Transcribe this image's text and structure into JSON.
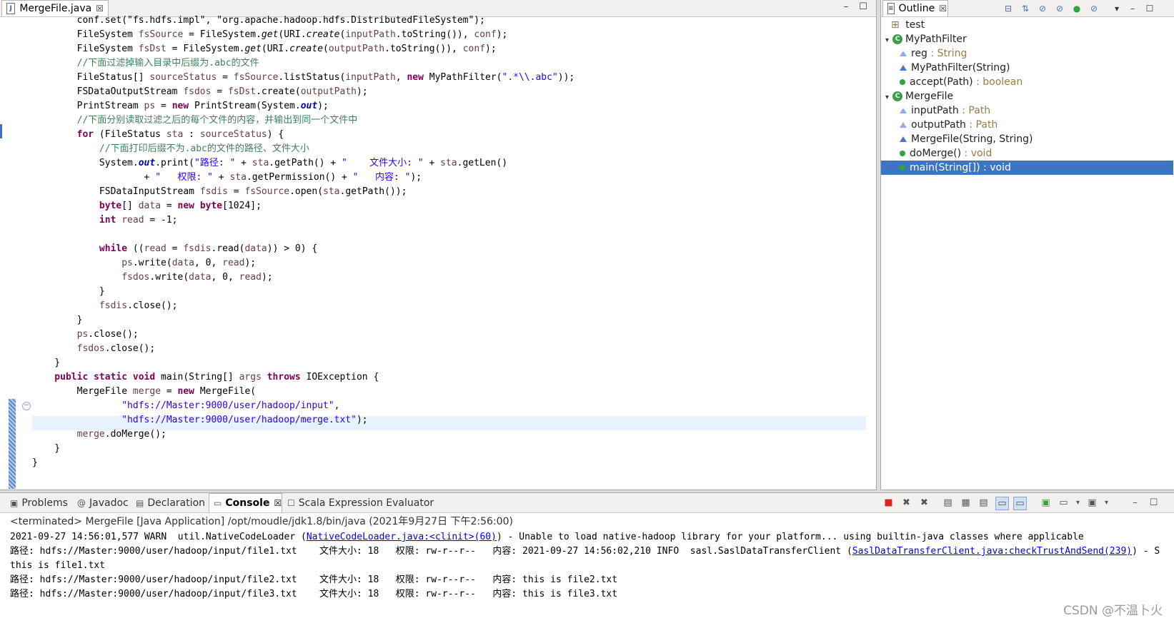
{
  "editor": {
    "tab_label": "MergeFile.java",
    "tab_close": "☒",
    "lines": [
      {
        "segs": [
          [
            "",
            "        conf.set(\"fs.hdfs.impl\", \"org.apache.hadoop.hdfs.DistributedFileSystem\");"
          ]
        ]
      },
      {
        "segs": [
          [
            "",
            "        FileSystem "
          ],
          [
            "var",
            "fsSource"
          ],
          [
            "",
            " = FileSystem."
          ],
          [
            "meth",
            "get"
          ],
          [
            "",
            "(URI."
          ],
          [
            "meth",
            "create"
          ],
          [
            "",
            "("
          ],
          [
            "var",
            "inputPath"
          ],
          [
            "",
            ".toString()), "
          ],
          [
            "var",
            "conf"
          ],
          [
            "",
            ");"
          ]
        ]
      },
      {
        "segs": [
          [
            "",
            "        FileSystem "
          ],
          [
            "var",
            "fsDst"
          ],
          [
            "",
            " = FileSystem."
          ],
          [
            "meth",
            "get"
          ],
          [
            "",
            "(URI."
          ],
          [
            "meth",
            "create"
          ],
          [
            "",
            "("
          ],
          [
            "var",
            "outputPath"
          ],
          [
            "",
            ".toString()), "
          ],
          [
            "var",
            "conf"
          ],
          [
            "",
            ");"
          ]
        ]
      },
      {
        "segs": [
          [
            "cmt",
            "        //下面过滤掉输入目录中后缀为.abc的文件"
          ]
        ]
      },
      {
        "segs": [
          [
            "",
            "        FileStatus[] "
          ],
          [
            "var",
            "sourceStatus"
          ],
          [
            "",
            " = "
          ],
          [
            "var",
            "fsSource"
          ],
          [
            "",
            ".listStatus("
          ],
          [
            "var",
            "inputPath"
          ],
          [
            "",
            ", "
          ],
          [
            "kw",
            "new"
          ],
          [
            "",
            " MyPathFilter("
          ],
          [
            "str",
            "\".*\\\\.abc\""
          ],
          [
            "",
            "));"
          ]
        ]
      },
      {
        "segs": [
          [
            "",
            "        FSDataOutputStream "
          ],
          [
            "var",
            "fsdos"
          ],
          [
            "",
            " = "
          ],
          [
            "var",
            "fsDst"
          ],
          [
            "",
            ".create("
          ],
          [
            "var",
            "outputPath"
          ],
          [
            "",
            ");"
          ]
        ]
      },
      {
        "segs": [
          [
            "",
            "        PrintStream "
          ],
          [
            "var",
            "ps"
          ],
          [
            "",
            " = "
          ],
          [
            "kw",
            "new"
          ],
          [
            "",
            " PrintStream(System."
          ],
          [
            "fld",
            "out"
          ],
          [
            "",
            ");"
          ]
        ]
      },
      {
        "segs": [
          [
            "cmt",
            "        //下面分别读取过滤之后的每个文件的内容，并输出到同一个文件中"
          ]
        ]
      },
      {
        "segs": [
          [
            "kw",
            "        for"
          ],
          [
            "",
            " (FileStatus "
          ],
          [
            "var",
            "sta"
          ],
          [
            "",
            " : "
          ],
          [
            "var",
            "sourceStatus"
          ],
          [
            "",
            ") {"
          ]
        ]
      },
      {
        "segs": [
          [
            "cmt",
            "            //下面打印后缀不为.abc的文件的路径、文件大小"
          ]
        ]
      },
      {
        "segs": [
          [
            "",
            "            System."
          ],
          [
            "fld",
            "out"
          ],
          [
            "",
            ".print("
          ],
          [
            "str",
            "\"路径: \""
          ],
          [
            "",
            " + "
          ],
          [
            "var",
            "sta"
          ],
          [
            "",
            ".getPath() + "
          ],
          [
            "str",
            "\"    文件大小: \""
          ],
          [
            "",
            " + "
          ],
          [
            "var",
            "sta"
          ],
          [
            "",
            ".getLen()"
          ]
        ]
      },
      {
        "segs": [
          [
            "",
            "                    + "
          ],
          [
            "str",
            "\"   权限: \""
          ],
          [
            "",
            " + "
          ],
          [
            "var",
            "sta"
          ],
          [
            "",
            ".getPermission() + "
          ],
          [
            "str",
            "\"   内容: \""
          ],
          [
            "",
            ");"
          ]
        ]
      },
      {
        "segs": [
          [
            "",
            "            FSDataInputStream "
          ],
          [
            "var",
            "fsdis"
          ],
          [
            "",
            " = "
          ],
          [
            "var",
            "fsSource"
          ],
          [
            "",
            ".open("
          ],
          [
            "var",
            "sta"
          ],
          [
            "",
            ".getPath());"
          ]
        ]
      },
      {
        "segs": [
          [
            "kw",
            "            byte"
          ],
          [
            "",
            "[] "
          ],
          [
            "var",
            "data"
          ],
          [
            "",
            " = "
          ],
          [
            "kw",
            "new"
          ],
          [
            "",
            " "
          ],
          [
            "kw",
            "byte"
          ],
          [
            "",
            "[1024];"
          ]
        ]
      },
      {
        "segs": [
          [
            "kw",
            "            int"
          ],
          [
            "",
            " "
          ],
          [
            "var",
            "read"
          ],
          [
            "",
            " = -1;"
          ]
        ]
      },
      {
        "segs": [
          [
            "",
            ""
          ]
        ]
      },
      {
        "segs": [
          [
            "kw",
            "            while"
          ],
          [
            "",
            " (("
          ],
          [
            "var",
            "read"
          ],
          [
            "",
            " = "
          ],
          [
            "var",
            "fsdis"
          ],
          [
            "",
            ".read("
          ],
          [
            "var",
            "data"
          ],
          [
            "",
            ")) > 0) {"
          ]
        ]
      },
      {
        "segs": [
          [
            "",
            "                "
          ],
          [
            "var",
            "ps"
          ],
          [
            "",
            ".write("
          ],
          [
            "var",
            "data"
          ],
          [
            "",
            ", 0, "
          ],
          [
            "var",
            "read"
          ],
          [
            "",
            ");"
          ]
        ]
      },
      {
        "segs": [
          [
            "",
            "                "
          ],
          [
            "var",
            "fsdos"
          ],
          [
            "",
            ".write("
          ],
          [
            "var",
            "data"
          ],
          [
            "",
            ", 0, "
          ],
          [
            "var",
            "read"
          ],
          [
            "",
            ");"
          ]
        ]
      },
      {
        "segs": [
          [
            "",
            "            }"
          ]
        ]
      },
      {
        "segs": [
          [
            "",
            "            "
          ],
          [
            "var",
            "fsdis"
          ],
          [
            "",
            ".close();"
          ]
        ]
      },
      {
        "segs": [
          [
            "",
            "        }"
          ]
        ]
      },
      {
        "segs": [
          [
            "",
            "        "
          ],
          [
            "var",
            "ps"
          ],
          [
            "",
            ".close();"
          ]
        ]
      },
      {
        "segs": [
          [
            "",
            "        "
          ],
          [
            "var",
            "fsdos"
          ],
          [
            "",
            ".close();"
          ]
        ]
      },
      {
        "segs": [
          [
            "",
            "    }"
          ]
        ]
      },
      {
        "segs": [
          [
            "kw",
            "    public static void"
          ],
          [
            "",
            " main(String[] "
          ],
          [
            "var",
            "args"
          ],
          [
            "",
            " "
          ],
          [
            "kw",
            "throws"
          ],
          [
            "",
            " IOException {"
          ]
        ]
      },
      {
        "segs": [
          [
            "",
            "        MergeFile "
          ],
          [
            "var",
            "merge"
          ],
          [
            "",
            " = "
          ],
          [
            "kw",
            "new"
          ],
          [
            "",
            " MergeFile("
          ]
        ]
      },
      {
        "segs": [
          [
            "",
            "                "
          ],
          [
            "str",
            "\"hdfs://Master:9000/user/hadoop/input\""
          ],
          [
            "",
            ","
          ]
        ]
      },
      {
        "segs": [
          [
            "",
            "                "
          ],
          [
            "str",
            "\"hdfs://Master:9000/user/hadoop/merge.txt\""
          ],
          [
            "",
            ");"
          ]
        ]
      },
      {
        "segs": [
          [
            "",
            "        "
          ],
          [
            "var",
            "merge"
          ],
          [
            "",
            ".doMerge();"
          ]
        ]
      },
      {
        "segs": [
          [
            "",
            "    }"
          ]
        ]
      },
      {
        "segs": [
          [
            "",
            "}"
          ]
        ]
      }
    ]
  },
  "outline": {
    "tab_label": "Outline",
    "tab_close": "☒",
    "items": [
      {
        "name": "test",
        "type": "",
        "icon": "import-icon"
      },
      {
        "name": "MyPathFilter",
        "type": "",
        "icon": "class-icon"
      },
      {
        "name": "reg",
        "type": " : String",
        "icon": "field-icon"
      },
      {
        "name": "MyPathFilter(String)",
        "type": "",
        "icon": "constructor-icon"
      },
      {
        "name": "accept(Path)",
        "type": " : boolean",
        "icon": "method-icon"
      },
      {
        "name": "MergeFile",
        "type": "",
        "icon": "class-icon"
      },
      {
        "name": "inputPath",
        "type": " : Path",
        "icon": "field-icon"
      },
      {
        "name": "outputPath",
        "type": " : Path",
        "icon": "field-icon"
      },
      {
        "name": "MergeFile(String, String)",
        "type": "",
        "icon": "constructor-icon"
      },
      {
        "name": "doMerge()",
        "type": " : void",
        "icon": "method-icon"
      },
      {
        "name": "main(String[])",
        "type": " : void",
        "icon": "static-method-icon"
      }
    ]
  },
  "console": {
    "tabs": [
      {
        "label": "Problems",
        "icon": "problems-icon"
      },
      {
        "label": "Javadoc",
        "icon": "javadoc-icon"
      },
      {
        "label": "Declaration",
        "icon": "declaration-icon"
      },
      {
        "label": "Console",
        "icon": "console-icon"
      },
      {
        "label": "Scala Expression Evaluator",
        "icon": "scala-icon"
      }
    ],
    "console_close": "☒",
    "status": "<terminated> MergeFile [Java Application] /opt/moudle/jdk1.8/bin/java (2021年9月27日 下午2:56:00)",
    "lines": [
      {
        "pre": "2021-09-27 14:56:01,577 WARN  util.NativeCodeLoader (",
        "link": "NativeCodeLoader.java:<clinit>(60)",
        "post": ") - Unable to load native-hadoop library for your platform... using builtin-java classes where applicable"
      },
      {
        "pre": "路径: hdfs://Master:9000/user/hadoop/input/file1.txt    文件大小: 18   权限: rw-r--r--   内容: 2021-09-27 14:56:02,210 INFO  sasl.SaslDataTransferClient (",
        "link": "SaslDataTransferClient.java:checkTrustAndSend(239)",
        "post": ") - S"
      },
      {
        "pre": "this is file1.txt",
        "link": "",
        "post": ""
      },
      {
        "pre": "路径: hdfs://Master:9000/user/hadoop/input/file2.txt    文件大小: 18   权限: rw-r--r--   内容: this is file2.txt",
        "link": "",
        "post": ""
      },
      {
        "pre": "路径: hdfs://Master:9000/user/hadoop/input/file3.txt    文件大小: 18   权限: rw-r--r--   内容: this is file3.txt",
        "link": "",
        "post": ""
      }
    ]
  },
  "watermark": "CSDN @不温卜火"
}
